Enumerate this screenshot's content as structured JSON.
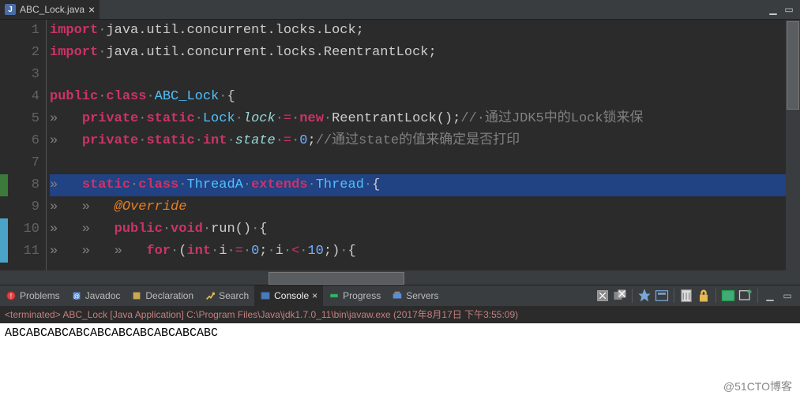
{
  "tab": {
    "title": "ABC_Lock.java",
    "icon_letter": "J"
  },
  "code": {
    "lines": [
      {
        "n": 1,
        "html": "<span class='kw'>import</span><span class='dot'>·</span><span class='pun'>java.util.concurrent.locks.Lock;</span>"
      },
      {
        "n": 2,
        "html": "<span class='kw'>import</span><span class='dot'>·</span><span class='pun'>java.util.concurrent.locks.ReentrantLock;</span>"
      },
      {
        "n": 3,
        "html": ""
      },
      {
        "n": 4,
        "html": "<span class='kw'>public</span><span class='dot'>·</span><span class='kw'>class</span><span class='dot'>·</span><span class='typ'>ABC_Lock</span><span class='dot'>·</span><span class='pun'>{</span>"
      },
      {
        "n": 5,
        "html": "<span class='dot'>»   </span><span class='kw'>private</span><span class='dot'>·</span><span class='kw'>static</span><span class='dot'>·</span><span class='typ'>Lock</span><span class='dot'>·</span><span class='var'>lock</span><span class='dot'>·</span><span class='op'>=</span><span class='dot'>·</span><span class='kw'>new</span><span class='dot'>·</span><span class='pun'>ReentrantLock();</span><span class='cmt'>//·通过JDK5中的Lock锁来保</span>"
      },
      {
        "n": 6,
        "html": "<span class='dot'>»   </span><span class='kw'>private</span><span class='dot'>·</span><span class='kw'>static</span><span class='dot'>·</span><span class='kw'>int</span><span class='dot'>·</span><span class='var'>state</span><span class='dot'>·</span><span class='op'>=</span><span class='dot'>·</span><span class='num'>0</span><span class='pun'>;</span><span class='cmt'>//通过state的值来确定是否打印</span>"
      },
      {
        "n": 7,
        "html": ""
      },
      {
        "n": 8,
        "hl": true,
        "html": "<span class='dot'>»   </span><span class='kw'>static</span><span class='dot'>·</span><span class='kw'>class</span><span class='dot'>·</span><span class='typ'>ThreadA</span><span class='dot'>·</span><span class='kw'>extends</span><span class='dot'>·</span><span class='typ'>Thread</span><span class='dot'>·</span><span class='pun'>{</span>"
      },
      {
        "n": 9,
        "html": "<span class='dot'>»   »   </span><span class='ann'>@Override</span>"
      },
      {
        "n": 10,
        "html": "<span class='dot'>»   »   </span><span class='kw'>public</span><span class='dot'>·</span><span class='kw'>void</span><span class='dot'>·</span><span class='pun'>run()</span><span class='dot'>·</span><span class='pun'>{</span>"
      },
      {
        "n": 11,
        "html": "<span class='dot'>»   »   »   </span><span class='kw'>for</span><span class='dot'>·</span><span class='pun'>(</span><span class='kw'>int</span><span class='dot'>·</span><span class='pun'>i</span><span class='dot'>·</span><span class='op'>=</span><span class='dot'>·</span><span class='num'>0</span><span class='pun'>;</span><span class='dot'>·</span><span class='pun'>i</span><span class='dot'>·</span><span class='op'>&lt;</span><span class='dot'>·</span><span class='num'>10</span><span class='pun'>;)</span><span class='dot'>·</span><span class='pun'>{</span>"
      }
    ]
  },
  "panel": {
    "tabs": [
      "Problems",
      "Javadoc",
      "Declaration",
      "Search",
      "Console",
      "Progress",
      "Servers"
    ],
    "active": 4
  },
  "status_line": "<terminated> ABC_Lock [Java Application] C:\\Program Files\\Java\\jdk1.7.0_11\\bin\\javaw.exe (2017年8月17日 下午3:55:09)",
  "console_output": "ABCABCABCABCABCABCABCABCABCABC",
  "watermark": "@51CTO博客"
}
